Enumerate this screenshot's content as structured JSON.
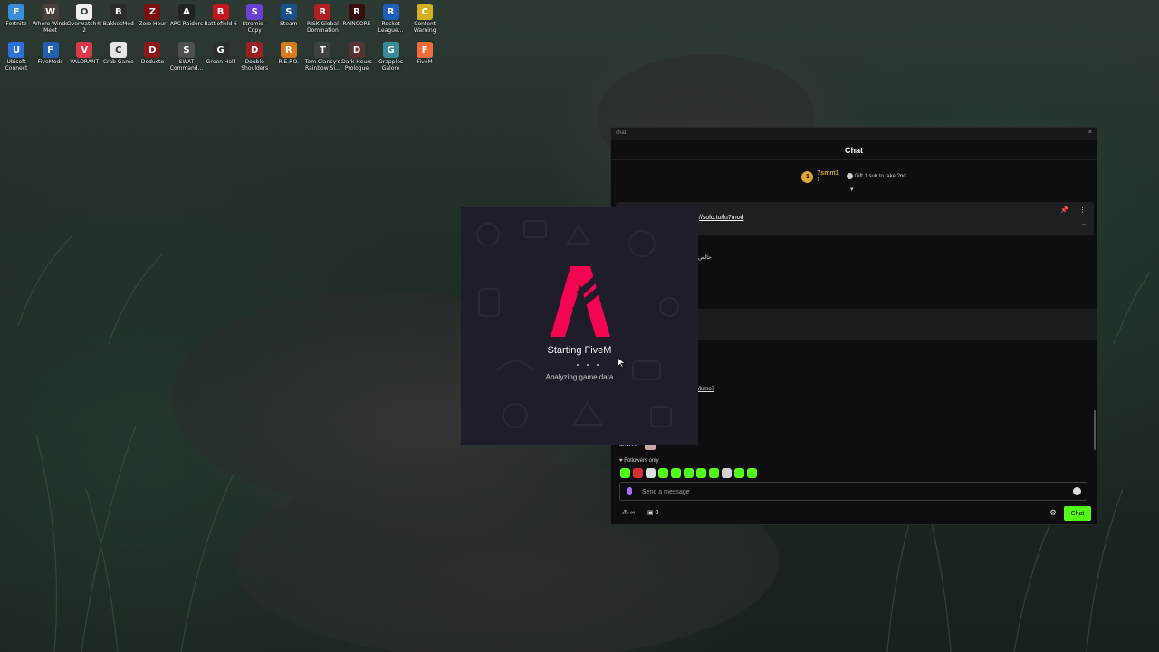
{
  "desktop": {
    "icons": [
      {
        "label": "Fortnite",
        "icon": "fortnite-icon",
        "color": "#3a8ed8",
        "glyph": "F"
      },
      {
        "label": "Where Winds Meet",
        "icon": "where-winds-meet-icon",
        "color": "#4a4035",
        "glyph": "W"
      },
      {
        "label": "Overwatch® 2",
        "icon": "overwatch-icon",
        "color": "#efefef",
        "glyph": "O"
      },
      {
        "label": "BakkesMod",
        "icon": "bakkesmod-icon",
        "color": "#2c2c2c",
        "glyph": "B"
      },
      {
        "label": "Zero Hour",
        "icon": "zero-hour-icon",
        "color": "#7a1010",
        "glyph": "Z"
      },
      {
        "label": "ARC Raiders",
        "icon": "arc-raiders-icon",
        "color": "#222222",
        "glyph": "A"
      },
      {
        "label": "Battlefield 6",
        "icon": "battlefield-icon",
        "color": "#c4161c",
        "glyph": "B"
      },
      {
        "label": "Stremio - Copy",
        "icon": "stremio-icon",
        "color": "#6a3fd4",
        "glyph": "S"
      },
      {
        "label": "Steam",
        "icon": "steam-icon",
        "color": "#1b4f8a",
        "glyph": "S"
      },
      {
        "label": "RISK Global Domination",
        "icon": "risk-icon",
        "color": "#b02020",
        "glyph": "R"
      },
      {
        "label": "RAINCORE",
        "icon": "raincore-icon",
        "color": "#3a0d0d",
        "glyph": "R"
      },
      {
        "label": "Rocket League...",
        "icon": "rocket-league-icon",
        "color": "#1f5fb8",
        "glyph": "R"
      },
      {
        "label": "Content Warning",
        "icon": "content-warning-icon",
        "color": "#d4b020",
        "glyph": "C"
      },
      {
        "label": "Ubisoft Connect",
        "icon": "ubisoft-connect-icon",
        "color": "#2b6fd8",
        "glyph": "U"
      },
      {
        "label": "FiveMods",
        "icon": "fivemods-icon",
        "color": "#2060b0",
        "glyph": "F"
      },
      {
        "label": "VALORANT",
        "icon": "valorant-icon",
        "color": "#d83848",
        "glyph": "V"
      },
      {
        "label": "Crab Game",
        "icon": "crab-game-icon",
        "color": "#e6e6e6",
        "glyph": "C"
      },
      {
        "label": "Deducto",
        "icon": "deducto-icon",
        "color": "#8a1818",
        "glyph": "D"
      },
      {
        "label": "SWAT Command...",
        "icon": "swat-command-icon",
        "color": "#505050",
        "glyph": "S"
      },
      {
        "label": "Green Hell",
        "icon": "green-hell-icon",
        "color": "#2d2d2d",
        "glyph": "G"
      },
      {
        "label": "Double Shoulders",
        "icon": "double-shoulders-icon",
        "color": "#9a2020",
        "glyph": "D"
      },
      {
        "label": "R.E.P.O.",
        "icon": "repo-icon",
        "color": "#d87a1a",
        "glyph": "R"
      },
      {
        "label": "Tom Clancy's Rainbow Si...",
        "icon": "rainbow-six-icon",
        "color": "#404040",
        "glyph": "T"
      },
      {
        "label": "Dark Hours Prologue",
        "icon": "dark-hours-icon",
        "color": "#5a3030",
        "glyph": "D"
      },
      {
        "label": "Grapples Galore",
        "icon": "grapples-galore-icon",
        "color": "#3a8a9a",
        "glyph": "G"
      },
      {
        "label": "FiveM",
        "icon": "fivem-icon",
        "color": "#f26b3a",
        "glyph": "F"
      }
    ]
  },
  "chat": {
    "window_title": "chat",
    "close_glyph": "×",
    "header": "Chat",
    "leaderboard": {
      "rank": "1",
      "user": "7smm1",
      "count": "1",
      "gift_text": "Gift 1 sub to take 2nd"
    },
    "expand_glyph": "▾",
    "pinned": {
      "text": "//solo.to/lu7mod"
    },
    "messages": {
      "arabic": "حالص",
      "link": "/lumo7",
      "user": "MTK20:"
    },
    "followers_only": "♥ Followers only",
    "input_placeholder": "Send a message",
    "footer": {
      "gift_count": "∞",
      "boxes": "0"
    },
    "chat_button": "Chat",
    "emote_colors": [
      "#53fc18",
      "#d83030",
      "#e0e0e0",
      "#53fc18",
      "#53fc18",
      "#53fc18",
      "#53fc18",
      "#53fc18",
      "#d0d0d0",
      "#53fc18",
      "#53fc18"
    ]
  },
  "fivem": {
    "title": "Starting FiveM",
    "status": "Analyzing game data",
    "accent": "#f40552"
  }
}
